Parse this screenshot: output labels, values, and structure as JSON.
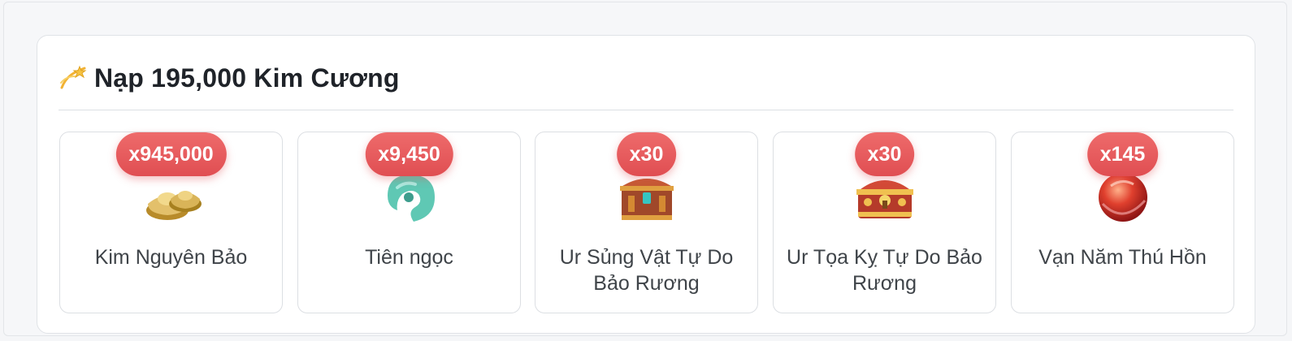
{
  "header": {
    "icon": "dizzy-star-icon",
    "title": "Nạp 195,000 Kim Cương"
  },
  "items": [
    {
      "quantity": "x945,000",
      "name": "Kim Nguyên Bảo",
      "icon": "gold-ingot-icon"
    },
    {
      "quantity": "x9,450",
      "name": "Tiên ngọc",
      "icon": "jade-pendant-icon"
    },
    {
      "quantity": "x30",
      "name": "Ur Sủng Vật Tự Do Bảo Rương",
      "icon": "pet-chest-icon"
    },
    {
      "quantity": "x30",
      "name": "Ur Tọa Kỵ Tự Do Bảo Rương",
      "icon": "mount-chest-icon"
    },
    {
      "quantity": "x145",
      "name": "Vạn Năm Thú Hồn",
      "icon": "beast-soul-orb-icon"
    }
  ],
  "colors": {
    "badge": "#e45558",
    "title": "#1f2329",
    "item_text": "#3f4449"
  }
}
